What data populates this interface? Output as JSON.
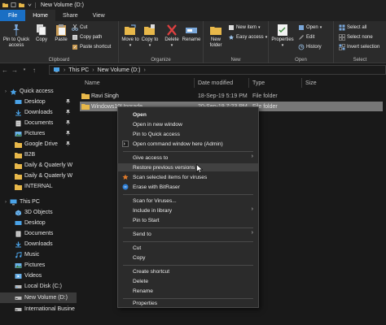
{
  "window": {
    "title": "New Volume (D:)"
  },
  "tabs": [
    {
      "label": "File"
    },
    {
      "label": "Home"
    },
    {
      "label": "Share"
    },
    {
      "label": "View"
    }
  ],
  "ribbon": {
    "clipboard": {
      "label": "Clipboard",
      "pin": "Pin to Quick access",
      "copy": "Copy",
      "paste": "Paste",
      "cut": "Cut",
      "copy_path": "Copy path",
      "paste_shortcut": "Paste shortcut"
    },
    "organize": {
      "label": "Organize",
      "move_to": "Move to",
      "copy_to": "Copy to",
      "delete": "Delete",
      "rename": "Rename"
    },
    "new": {
      "label": "New",
      "new_folder": "New folder",
      "new_item": "New item",
      "easy_access": "Easy access"
    },
    "open": {
      "label": "Open",
      "properties": "Properties",
      "open": "Open",
      "edit": "Edit",
      "history": "History"
    },
    "select": {
      "label": "Select",
      "select_all": "Select all",
      "select_none": "Select none",
      "invert": "Invert selection"
    }
  },
  "address": {
    "crumbs": [
      "This PC",
      "New Volume (D:)"
    ]
  },
  "nav": {
    "items": [
      {
        "label": "Quick access",
        "icon": "star-icon"
      },
      {
        "label": "Desktop",
        "icon": "desktop-icon",
        "pinned": true
      },
      {
        "label": "Downloads",
        "icon": "download-icon",
        "pinned": true
      },
      {
        "label": "Documents",
        "icon": "document-icon",
        "pinned": true
      },
      {
        "label": "Pictures",
        "icon": "picture-icon",
        "pinned": true
      },
      {
        "label": "Google Drive",
        "icon": "folder-icon",
        "pinned": true
      },
      {
        "label": "B2B",
        "icon": "folder-icon"
      },
      {
        "label": "Daily & Quaterly W",
        "icon": "folder-icon"
      },
      {
        "label": "Daily & Quaterly W",
        "icon": "folder-icon"
      },
      {
        "label": "INTERNAL",
        "icon": "folder-icon"
      },
      {
        "label": "This PC",
        "icon": "pc-icon"
      },
      {
        "label": "3D Objects",
        "icon": "cube-icon"
      },
      {
        "label": "Desktop",
        "icon": "desktop-icon"
      },
      {
        "label": "Documents",
        "icon": "document-icon"
      },
      {
        "label": "Downloads",
        "icon": "download-icon"
      },
      {
        "label": "Music",
        "icon": "music-icon"
      },
      {
        "label": "Pictures",
        "icon": "picture-icon"
      },
      {
        "label": "Videos",
        "icon": "video-icon"
      },
      {
        "label": "Local Disk (C:)",
        "icon": "drive-icon"
      },
      {
        "label": "New Volume (D:)",
        "icon": "drive-icon",
        "selected": true
      },
      {
        "label": "International Busine",
        "icon": "drive-icon"
      }
    ]
  },
  "columns": {
    "name": "Name",
    "date": "Date modified",
    "type": "Type",
    "size": "Size"
  },
  "files": [
    {
      "name": "Ravi Singh",
      "date": "18-Sep-19 5:19 PM",
      "type": "File folder"
    },
    {
      "name": "Windows10Upgrade",
      "date": "20-Sep-19 7:23 PM",
      "type": "File folder"
    }
  ],
  "context_menu": {
    "items": [
      {
        "label": "Open",
        "bold": true
      },
      {
        "label": "Open in new window"
      },
      {
        "label": "Pin to Quick access"
      },
      {
        "label": "Open command window here (Admin)",
        "icon": "terminal-icon"
      },
      {
        "label": "Give access to",
        "submenu": true
      },
      {
        "label": "Restore previous versions",
        "hover": true
      },
      {
        "label": "Scan selected items for viruses",
        "icon": "antivirus-icon"
      },
      {
        "label": "Erase with BitRaser",
        "icon": "bitraser-icon"
      },
      {
        "label": "Scan for Viruses..."
      },
      {
        "label": "Include in library",
        "submenu": true
      },
      {
        "label": "Pin to Start"
      },
      {
        "label": "Send to",
        "submenu": true
      },
      {
        "label": "Cut"
      },
      {
        "label": "Copy"
      },
      {
        "label": "Create shortcut"
      },
      {
        "label": "Delete"
      },
      {
        "label": "Rename"
      },
      {
        "label": "Properties"
      }
    ]
  },
  "colors": {
    "accent": "#1a6fc4",
    "folder": "#e8b84a",
    "background": "#191919",
    "ribbon": "#2b2b2b"
  }
}
